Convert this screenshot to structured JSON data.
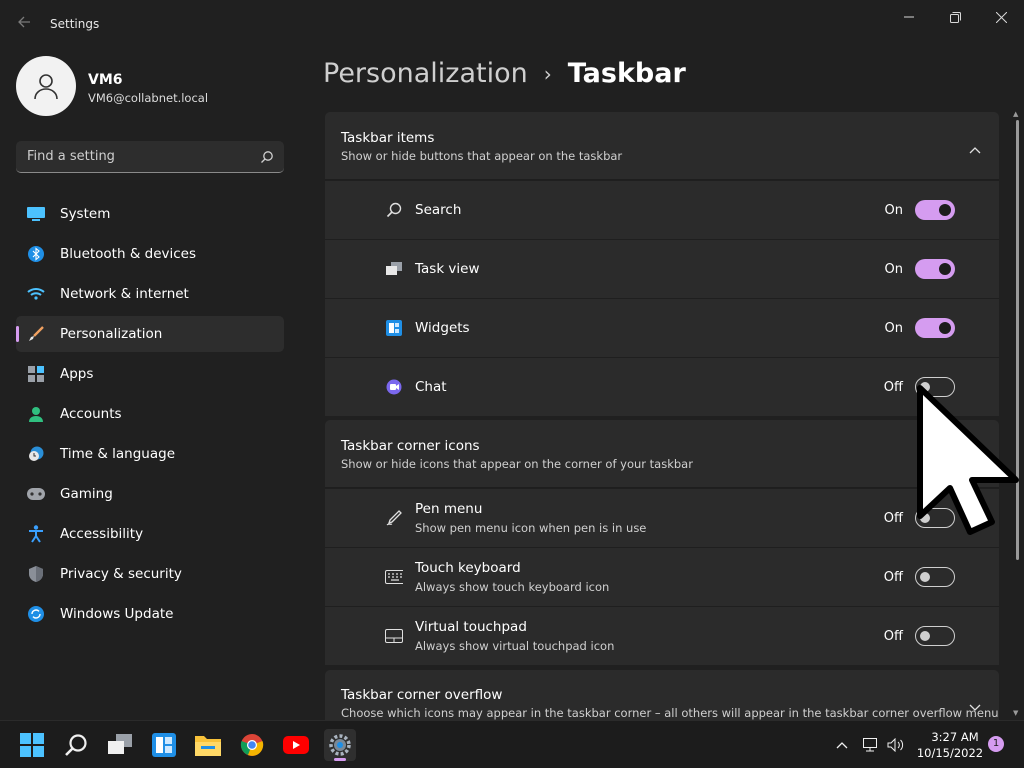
{
  "window": {
    "title": "Settings",
    "controls": [
      "minimize",
      "maximize",
      "close"
    ]
  },
  "user": {
    "name": "VM6",
    "email": "VM6@collabnet.local"
  },
  "search": {
    "placeholder": "Find a setting"
  },
  "sidebar": {
    "items": [
      {
        "label": "System",
        "icon": "system-icon"
      },
      {
        "label": "Bluetooth & devices",
        "icon": "bluetooth-icon"
      },
      {
        "label": "Network & internet",
        "icon": "wifi-icon"
      },
      {
        "label": "Personalization",
        "icon": "brush-icon",
        "active": true
      },
      {
        "label": "Apps",
        "icon": "apps-icon"
      },
      {
        "label": "Accounts",
        "icon": "accounts-icon"
      },
      {
        "label": "Time & language",
        "icon": "clock-globe-icon"
      },
      {
        "label": "Gaming",
        "icon": "gamepad-icon"
      },
      {
        "label": "Accessibility",
        "icon": "accessibility-icon"
      },
      {
        "label": "Privacy & security",
        "icon": "shield-icon"
      },
      {
        "label": "Windows Update",
        "icon": "update-icon"
      }
    ]
  },
  "breadcrumb": {
    "parent": "Personalization",
    "separator": "›",
    "current": "Taskbar"
  },
  "sections": {
    "taskbar_items": {
      "title": "Taskbar items",
      "description": "Show or hide buttons that appear on the taskbar",
      "rows": [
        {
          "label": "Search",
          "state": "On",
          "on": true
        },
        {
          "label": "Task view",
          "state": "On",
          "on": true
        },
        {
          "label": "Widgets",
          "state": "On",
          "on": true
        },
        {
          "label": "Chat",
          "state": "Off",
          "on": false
        }
      ]
    },
    "corner_icons": {
      "title": "Taskbar corner icons",
      "description": "Show or hide icons that appear on the corner of your taskbar",
      "rows": [
        {
          "label": "Pen menu",
          "sub": "Show pen menu icon when pen is in use",
          "state": "Off",
          "on": false
        },
        {
          "label": "Touch keyboard",
          "sub": "Always show touch keyboard icon",
          "state": "Off",
          "on": false
        },
        {
          "label": "Virtual touchpad",
          "sub": "Always show virtual touchpad icon",
          "state": "Off",
          "on": false
        }
      ]
    },
    "corner_overflow": {
      "title": "Taskbar corner overflow",
      "description": "Choose which icons may appear in the taskbar corner – all others will appear in the taskbar corner overflow menu"
    }
  },
  "taskbar": {
    "apps": [
      "start-icon",
      "search-icon",
      "task-view-icon",
      "widgets-icon",
      "file-explorer-icon",
      "chrome-icon",
      "youtube-icon",
      "settings-icon"
    ],
    "clock": {
      "time": "3:27 AM",
      "date": "10/15/2022"
    },
    "notification_count": "1"
  },
  "colors": {
    "accent": "#d59cf0",
    "background": "#202020",
    "panel": "#2b2b2b"
  }
}
